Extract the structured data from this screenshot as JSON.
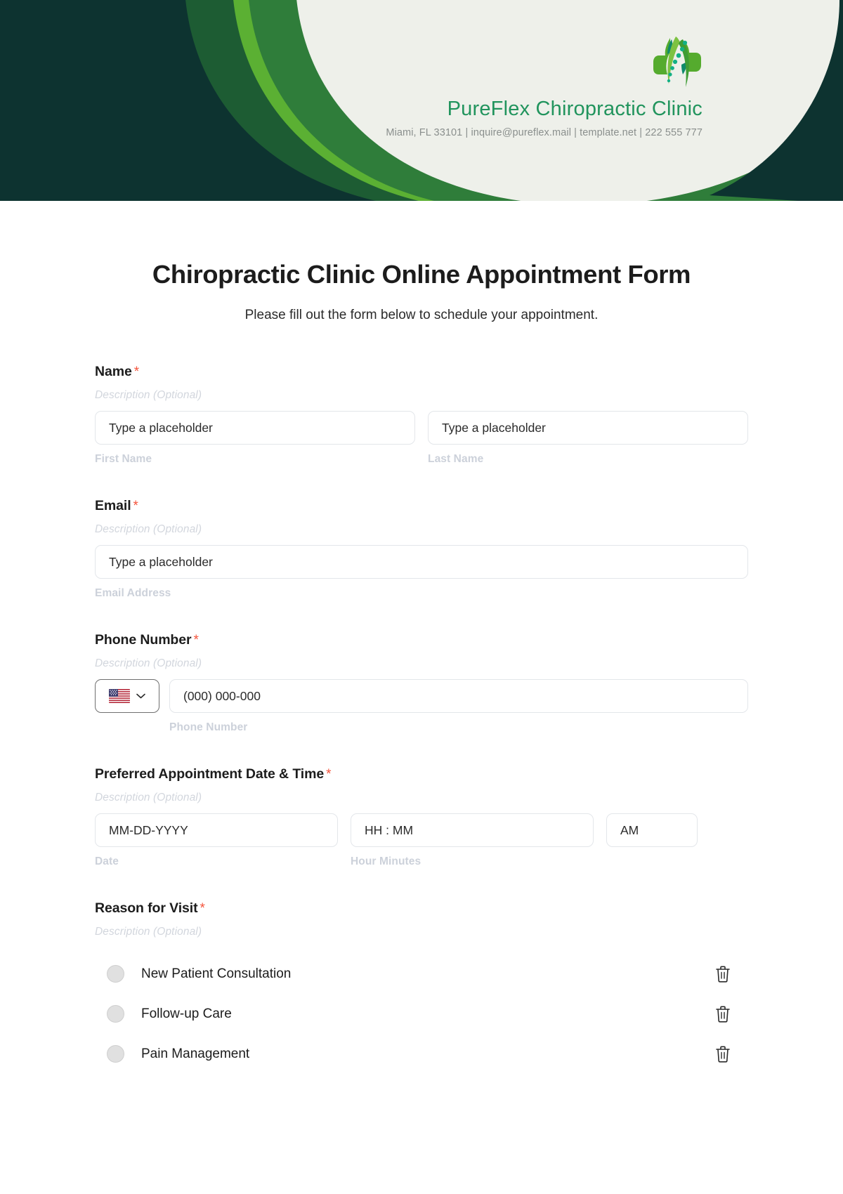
{
  "header": {
    "brand_name": "PureFlex Chiropractic Clinic",
    "contact_line": "Miami, FL 33101 | inquire@pureflex.mail | template.net | 222 555 777",
    "logo_icon": "chiropractic-spine-cross-logo",
    "colors": {
      "dark_teal": "#0d3330",
      "deep_green": "#1d5c33",
      "mid_green": "#2f7d3a",
      "bright_green": "#5bb033",
      "cream": "#eef0ea",
      "brand_text": "#21945d"
    }
  },
  "form": {
    "title": "Chiropractic Clinic Online Appointment Form",
    "subtitle": "Please fill out the form below to schedule your appointment.",
    "required_marker": "*",
    "description_placeholder": "Description (Optional)",
    "fields": {
      "name": {
        "label": "Name",
        "description": "Description (Optional)",
        "first": {
          "placeholder": "Type a placeholder",
          "value": "",
          "sub_label": "First Name"
        },
        "last": {
          "placeholder": "Type a placeholder",
          "value": "",
          "sub_label": "Last Name"
        }
      },
      "email": {
        "label": "Email",
        "description": "Description (Optional)",
        "placeholder": "Type a placeholder",
        "value": "",
        "sub_label": "Email Address"
      },
      "phone": {
        "label": "Phone Number",
        "description": "Description (Optional)",
        "country_flag": "us-flag-icon",
        "country_chevron": "chevron-down-icon",
        "placeholder": "(000) 000-000",
        "value": "",
        "sub_label": "Phone Number"
      },
      "datetime": {
        "label": "Preferred Appointment Date & Time",
        "description": "Description (Optional)",
        "date": {
          "placeholder": "MM-DD-YYYY",
          "value": "",
          "sub_label": "Date"
        },
        "time": {
          "placeholder": "HH : MM",
          "value": "",
          "sub_label": "Hour Minutes"
        },
        "meridiem": {
          "placeholder": "AM",
          "value": "",
          "sub_label": ""
        }
      },
      "reason": {
        "label": "Reason for Visit",
        "description": "Description (Optional)",
        "options": [
          {
            "label": "New Patient Consultation",
            "selected": false,
            "delete_icon": "trash-icon"
          },
          {
            "label": "Follow-up Care",
            "selected": false,
            "delete_icon": "trash-icon"
          },
          {
            "label": "Pain Management",
            "selected": false,
            "delete_icon": "trash-icon"
          }
        ]
      }
    }
  }
}
